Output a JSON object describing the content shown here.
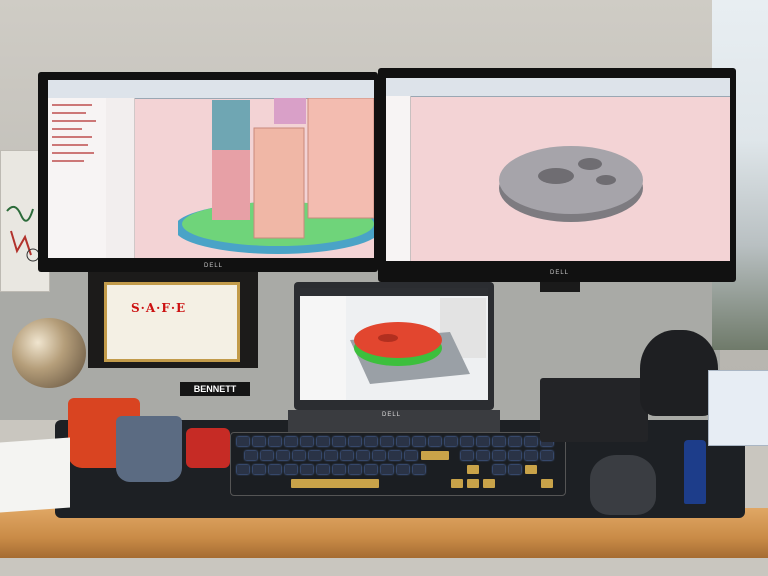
{
  "scene": {
    "description_labels": {
      "laptop_brand": "DELL",
      "name_plate": "BENNETT",
      "certificate_title": "S·A·F·E",
      "left_monitor_brand": "DELL",
      "right_monitor_brand": "DELL"
    },
    "icons": [
      "monitor-icon",
      "laptop-icon",
      "keyboard-icon",
      "mouse-icon",
      "mug-icon"
    ],
    "colors": {
      "cad_background": "#f3d3d5",
      "desk_wood": "#c98b47",
      "mat": "#1d2024",
      "mug_orange": "#d94421",
      "mug_blue": "#5b6b82",
      "slicer_part_red": "#e2462f",
      "slicer_part_green": "#3dbf3d"
    }
  }
}
